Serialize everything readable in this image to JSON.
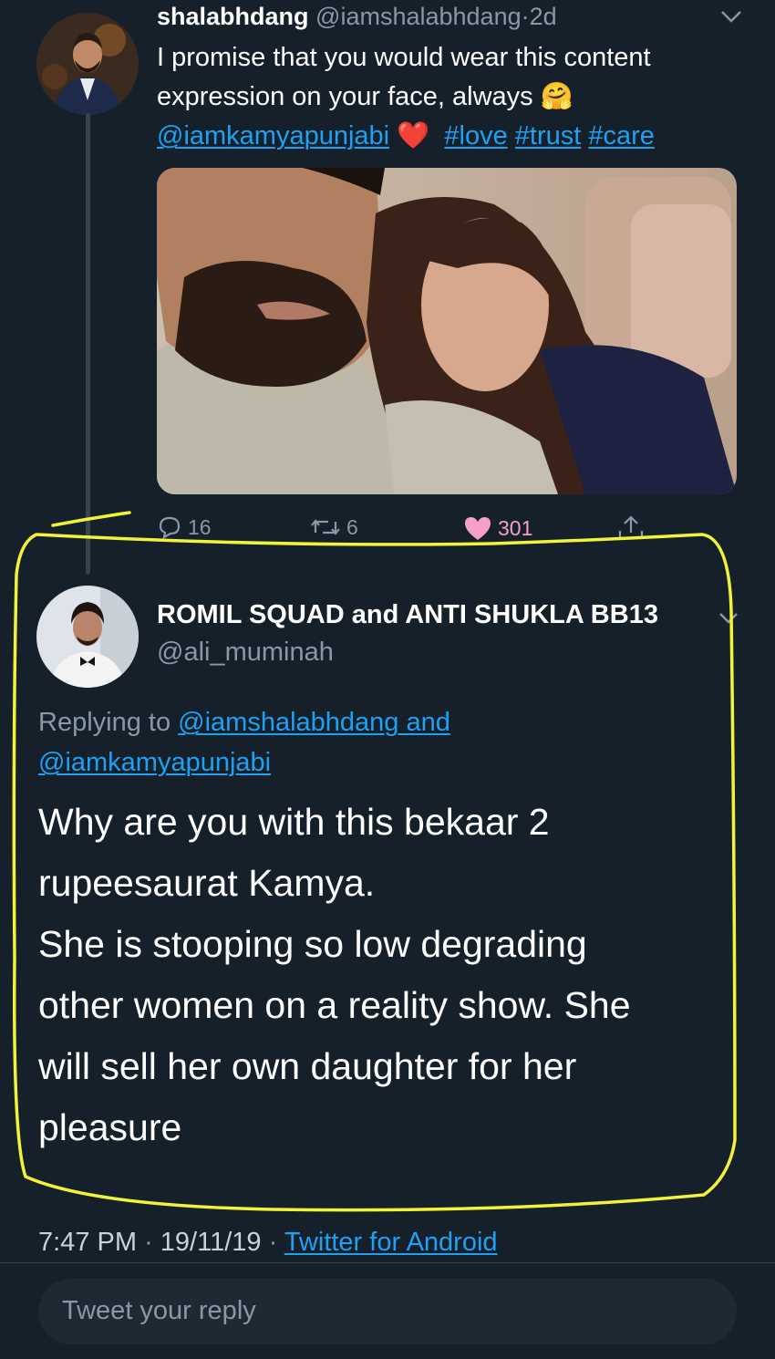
{
  "original_tweet": {
    "display_name": "shalabhdang",
    "handle": "@iamshalabhdang",
    "separator": "·",
    "age": "2d",
    "text_line1": "I promise that you would wear this content",
    "text_line2": "expression on your face, always",
    "emoji_hug": "🤗",
    "mention": "@iamkamyapunjabi",
    "emoji_heart": "❤️",
    "hashtags": [
      "#love",
      "#trust",
      "#care"
    ],
    "actions": {
      "replies": "16",
      "retweets": "6",
      "likes": "301"
    }
  },
  "reply_tweet": {
    "display_name": "ROMIL SQUAD and ANTI SHUKLA BB13",
    "handle": "@ali_muminah",
    "replying_prefix": "Replying to",
    "replying_link1": "@iamshalabhdang and",
    "replying_link2": "@iamkamyapunjabi",
    "body_lines": [
      "Why are you with this bekaar 2",
      "rupeesaurat Kamya.",
      "She is stooping so low degrading",
      "other women on a reality show. She",
      "will sell her own daughter for her",
      "pleasure"
    ],
    "time": "7:47 PM",
    "date": "19/11/19",
    "separator": "·",
    "source": "Twitter for Android"
  },
  "composer": {
    "placeholder": "Tweet your reply"
  },
  "colors": {
    "background": "#15202b",
    "accent": "#1da1f2",
    "muted": "#8899a6",
    "like": "#f4a0c8",
    "annotation": "#f2f23a"
  }
}
